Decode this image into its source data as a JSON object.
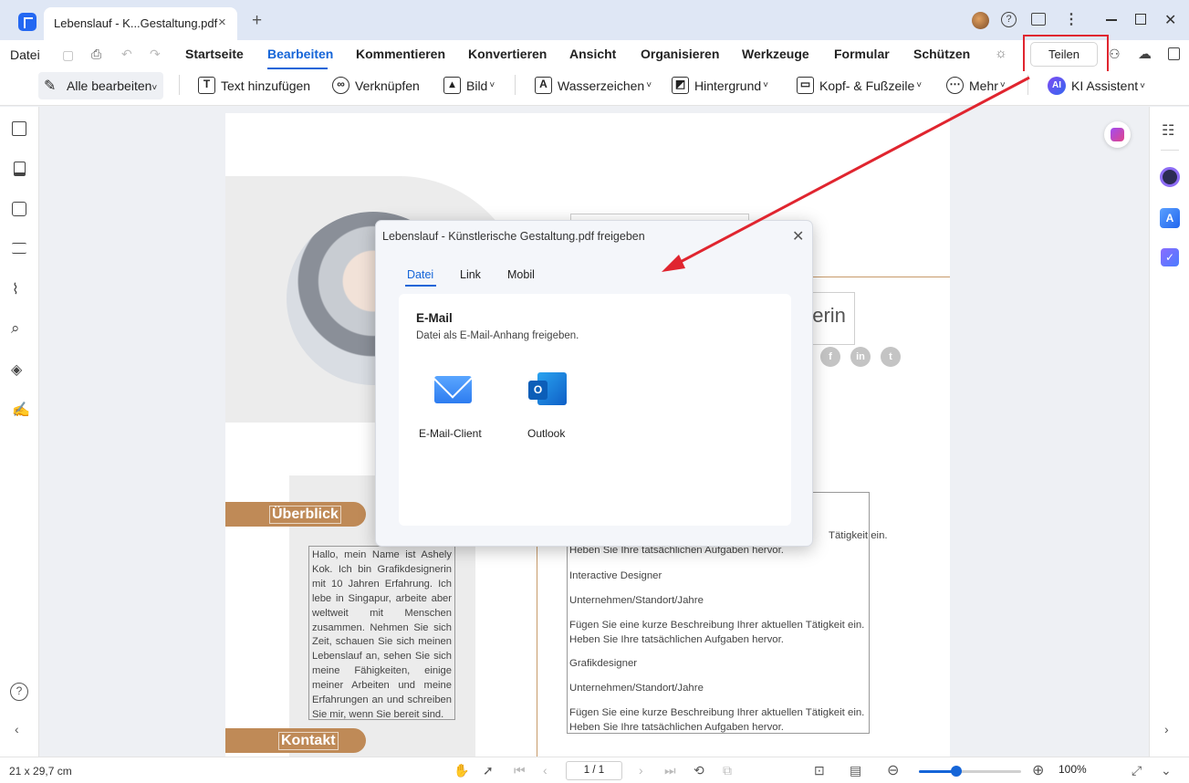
{
  "window": {
    "tab_title": "Lebenslauf - K...Gestaltung.pdf",
    "tab_close": "×",
    "new_tab": "+",
    "help_glyph": "?",
    "kebab": "⋮",
    "close": "✕"
  },
  "menubar": {
    "file": "Datei",
    "items": [
      "Startseite",
      "Bearbeiten",
      "Kommentieren",
      "Konvertieren",
      "Ansicht",
      "Organisieren",
      "Werkzeuge",
      "Formular",
      "Schützen"
    ],
    "active": "Bearbeiten",
    "share_button": "Teilen"
  },
  "toolbar": {
    "edit_all": "Alle bearbeiten",
    "add_text": "Text hinzufügen",
    "link": "Verknüpfen",
    "image": "Bild",
    "watermark": "Wasserzeichen",
    "background": "Hintergrund",
    "header_footer": "Kopf- & Fußzeile",
    "more": "Mehr",
    "ai_badge": "AI",
    "ai_assistant": "KI Assistent",
    "caret": "˅"
  },
  "document": {
    "subtitle_fragment": "herin",
    "social_icons": [
      "f",
      "in",
      "t"
    ],
    "section_overview": "Überblick",
    "section_contact": "Kontakt",
    "intro_text": "Hallo, mein Name ist Ashely Kok. Ich bin Grafikdesignerin mit 10 Jahren Erfahrung. Ich lebe in Singapur, arbeite aber weltweit mit Menschen zusammen. Nehmen Sie sich Zeit, schauen Sie sich meinen Lebenslauf an, sehen Sie sich meine Fähigkeiten, einige meiner Arbeiten und meine Erfahrungen an und schreiben Sie mir, wenn Sie bereit sind.",
    "experience_lines": [
      "Tätigkeit ein.",
      "Heben Sie Ihre tatsächlichen Aufgaben hervor.",
      "Interactive Designer",
      "Unternehmen/Standort/Jahre",
      "Fügen Sie eine kurze Beschreibung Ihrer aktuellen Tätigkeit ein.",
      "Heben Sie Ihre tatsächlichen Aufgaben hervor.",
      "Grafikdesigner",
      "Unternehmen/Standort/Jahre",
      "Fügen Sie eine kurze Beschreibung Ihrer aktuellen Tätigkeit ein.",
      "Heben Sie Ihre tatsächlichen Aufgaben hervor."
    ]
  },
  "dialog": {
    "title": "Lebenslauf - Künstlerische Gestaltung.pdf freigeben",
    "close": "✕",
    "tabs": [
      "Datei",
      "Link",
      "Mobil"
    ],
    "active_tab": "Datei",
    "section_title": "E-Mail",
    "section_desc": "Datei als E-Mail-Anhang freigeben.",
    "options": [
      "E-Mail-Client",
      "Outlook"
    ],
    "outlook_letter": "O"
  },
  "statusbar": {
    "page_size": "21 x 29,7 cm",
    "page_indicator": "1 / 1",
    "zoom": "100%",
    "zoom_fraction": 0.37
  },
  "annotation": {
    "color": "#e0252f"
  }
}
